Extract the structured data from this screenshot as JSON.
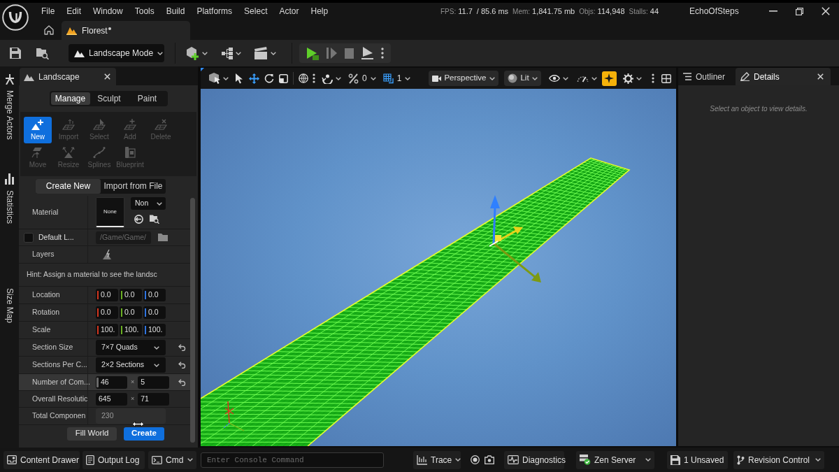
{
  "title_bar": {
    "menu": [
      "File",
      "Edit",
      "Window",
      "Tools",
      "Build",
      "Platforms",
      "Select",
      "Actor",
      "Help"
    ],
    "stats": [
      {
        "label": "FPS:",
        "value": "11.7"
      },
      {
        "value": "/ 85.6 ms"
      },
      {
        "label": "Mem:",
        "value": "1,841.75 mb"
      },
      {
        "label": "Objs:",
        "value": "114,948"
      },
      {
        "label": "Stalls:",
        "value": "44"
      }
    ],
    "project": "EchoOfSteps",
    "level_tab": {
      "title": "Florest",
      "unsaved": true
    }
  },
  "toolbar": {
    "mode": "Landscape Mode"
  },
  "side_tabs": [
    "Merge Actors",
    "Statistics",
    "Size Map"
  ],
  "landscape_panel": {
    "title": "Landscape",
    "mode_tabs": [
      {
        "label": "Manage",
        "selected": true
      },
      {
        "label": "Sculpt",
        "selected": false
      },
      {
        "label": "Paint",
        "selected": false
      }
    ],
    "tools": [
      {
        "label": "New",
        "selected": true,
        "disabled": false
      },
      {
        "label": "Import",
        "selected": false,
        "disabled": true
      },
      {
        "label": "Select",
        "selected": false,
        "disabled": true
      },
      {
        "label": "Add",
        "selected": false,
        "disabled": true
      },
      {
        "label": "Delete",
        "selected": false,
        "disabled": true
      },
      {
        "label": "Move",
        "selected": false,
        "disabled": true
      },
      {
        "label": "Resize",
        "selected": false,
        "disabled": true
      },
      {
        "label": "Splines",
        "selected": false,
        "disabled": true
      },
      {
        "label": "Blueprint",
        "selected": false,
        "disabled": true
      }
    ],
    "source_tabs": [
      {
        "label": "Create New",
        "selected": true
      },
      {
        "label": "Import from File",
        "selected": false
      }
    ],
    "properties": [
      {
        "kind": "material",
        "label": "Material",
        "thumbnail": "None",
        "dropdown": "Non",
        "reset": false,
        "highlighted": false
      },
      {
        "kind": "checkbox",
        "label": "Default L...",
        "checked": false,
        "path": "/Game/Game/",
        "reset": false,
        "highlighted": false
      },
      {
        "kind": "layers",
        "label": "Layers",
        "reset": false,
        "highlighted": false
      },
      {
        "kind": "hint",
        "label": "Hint: Assign a material to see the landsc",
        "reset": false,
        "highlighted": false
      },
      {
        "kind": "vector",
        "label": "Location",
        "values": [
          "0.0",
          "0.0",
          "0.0"
        ],
        "reset": false,
        "highlighted": false
      },
      {
        "kind": "vector",
        "label": "Rotation",
        "values": [
          "0.0",
          "0.0",
          "0.0"
        ],
        "reset": false,
        "highlighted": false
      },
      {
        "kind": "vector",
        "label": "Scale",
        "values": [
          "100.",
          "100.",
          "100."
        ],
        "reset": false,
        "highlighted": false
      },
      {
        "kind": "dropdown",
        "label": "Section Size",
        "value": "7×7 Quads",
        "reset": true,
        "highlighted": false
      },
      {
        "kind": "dropdown",
        "label": "Sections Per C...",
        "value": "2×2 Sections",
        "reset": true,
        "highlighted": false
      },
      {
        "kind": "pair",
        "label": "Number of Com...",
        "values": [
          "46",
          "5"
        ],
        "separator": "×",
        "reset": true,
        "highlighted": true
      },
      {
        "kind": "pair",
        "label": "Overall Resolutic",
        "values": [
          "645",
          "71"
        ],
        "separator": "×",
        "reset": false,
        "highlighted": false
      },
      {
        "kind": "readonly",
        "label": "Total Componen",
        "value": "230",
        "reset": false,
        "highlighted": false
      }
    ],
    "buttons": [
      {
        "label": "Fill World",
        "kind": "secondary"
      },
      {
        "label": "Create",
        "kind": "primary"
      }
    ]
  },
  "viewport": {
    "transform_tools": [
      {
        "selected": false
      },
      {
        "selected": true
      },
      {
        "selected": false
      },
      {
        "selected": false
      }
    ],
    "snaps": [
      {
        "kind": "percent",
        "value": "0",
        "on": false
      },
      {
        "kind": "grid",
        "value": "1",
        "on": true
      }
    ],
    "view_mode": "Perspective",
    "lighting": "Lit",
    "realtime": true
  },
  "details_panel": {
    "tabs": [
      {
        "label": "Outliner",
        "selected": false
      },
      {
        "label": "Details",
        "selected": true
      }
    ],
    "message": "Select an object to view details."
  },
  "status_bar": {
    "content_drawer": "Content Drawer",
    "output_log": "Output Log",
    "cmd": "Cmd",
    "console_placeholder": "Enter Console Command",
    "trace": "Trace",
    "diagnostics": "Diagnostics",
    "zen_server": "Zen Server",
    "unsaved": "1 Unsaved",
    "revision_control": "Revision Control"
  }
}
